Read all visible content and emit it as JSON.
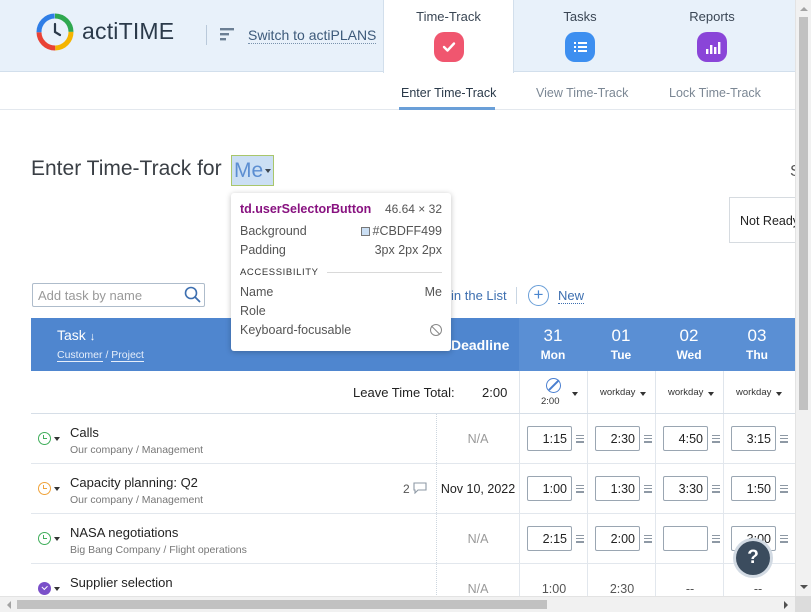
{
  "brand": {
    "name": "actiTIME",
    "switch_link": "Switch to actiPLANS"
  },
  "tabs": [
    {
      "label": "Time-Track",
      "color": "#f0566f"
    },
    {
      "label": "Tasks",
      "color": "#3d8ff0"
    },
    {
      "label": "Reports",
      "color": "#8a45d8"
    }
  ],
  "subnav": {
    "enter": "Enter Time-Track",
    "view": "View Time-Track",
    "lock": "Lock Time-Track"
  },
  "title": {
    "prefix": "Enter Time-Track for",
    "user": "Me"
  },
  "right_fragment": {
    "top": "S",
    "ready": "Not Ready"
  },
  "tooltip": {
    "selector": "td.userSelectorButton",
    "dims": "46.64 × 32",
    "bg_label": "Background",
    "bg_value": "#CBDFF499",
    "padding_label": "Padding",
    "padding_value": "3px 2px 2px",
    "section": "ACCESSIBILITY",
    "name_label": "Name",
    "name_value": "Me",
    "role_label": "Role",
    "kbd_label": "Keyboard-focusable"
  },
  "toolbar": {
    "add_placeholder": "Add task by name",
    "in_list": "in the List",
    "new": "New"
  },
  "table": {
    "task_header": "Task",
    "task_arrow": "↓",
    "customer": "Customer",
    "project": "Project",
    "slash": "/",
    "deadline_header": "Deadline",
    "days": [
      {
        "num": "31",
        "wd": "Mon"
      },
      {
        "num": "01",
        "wd": "Tue"
      },
      {
        "num": "02",
        "wd": "Wed"
      },
      {
        "num": "03",
        "wd": "Thu"
      }
    ],
    "leave_label": "Leave Time Total:",
    "leave_total": "2:00",
    "day_types": [
      "2:00",
      "workday",
      "workday",
      "workday"
    ],
    "rows": [
      {
        "name": "Calls",
        "customer": "Our company",
        "project": "Management",
        "deadline": "N/A",
        "comments": "",
        "times": [
          "1:15",
          "2:30",
          "4:50",
          "3:15"
        ],
        "icon": "green-clock"
      },
      {
        "name": "Capacity planning: Q2",
        "customer": "Our company",
        "project": "Management",
        "deadline": "Nov 10, 2022",
        "comments": "2",
        "times": [
          "1:00",
          "1:30",
          "3:30",
          "1:50"
        ],
        "icon": "orange-clock"
      },
      {
        "name": "NASA negotiations",
        "customer": "Big Bang Company",
        "project": "Flight operations",
        "deadline": "N/A",
        "comments": "",
        "times": [
          "2:15",
          "2:00",
          "",
          "3:00"
        ],
        "icon": "green-clock"
      },
      {
        "name": "Supplier selection",
        "customer": "",
        "project": "",
        "deadline": "N/A",
        "comments": "",
        "times": [
          "1:00",
          "2:30",
          "--",
          "--"
        ],
        "icon": "purple-check"
      }
    ]
  },
  "help": "?"
}
